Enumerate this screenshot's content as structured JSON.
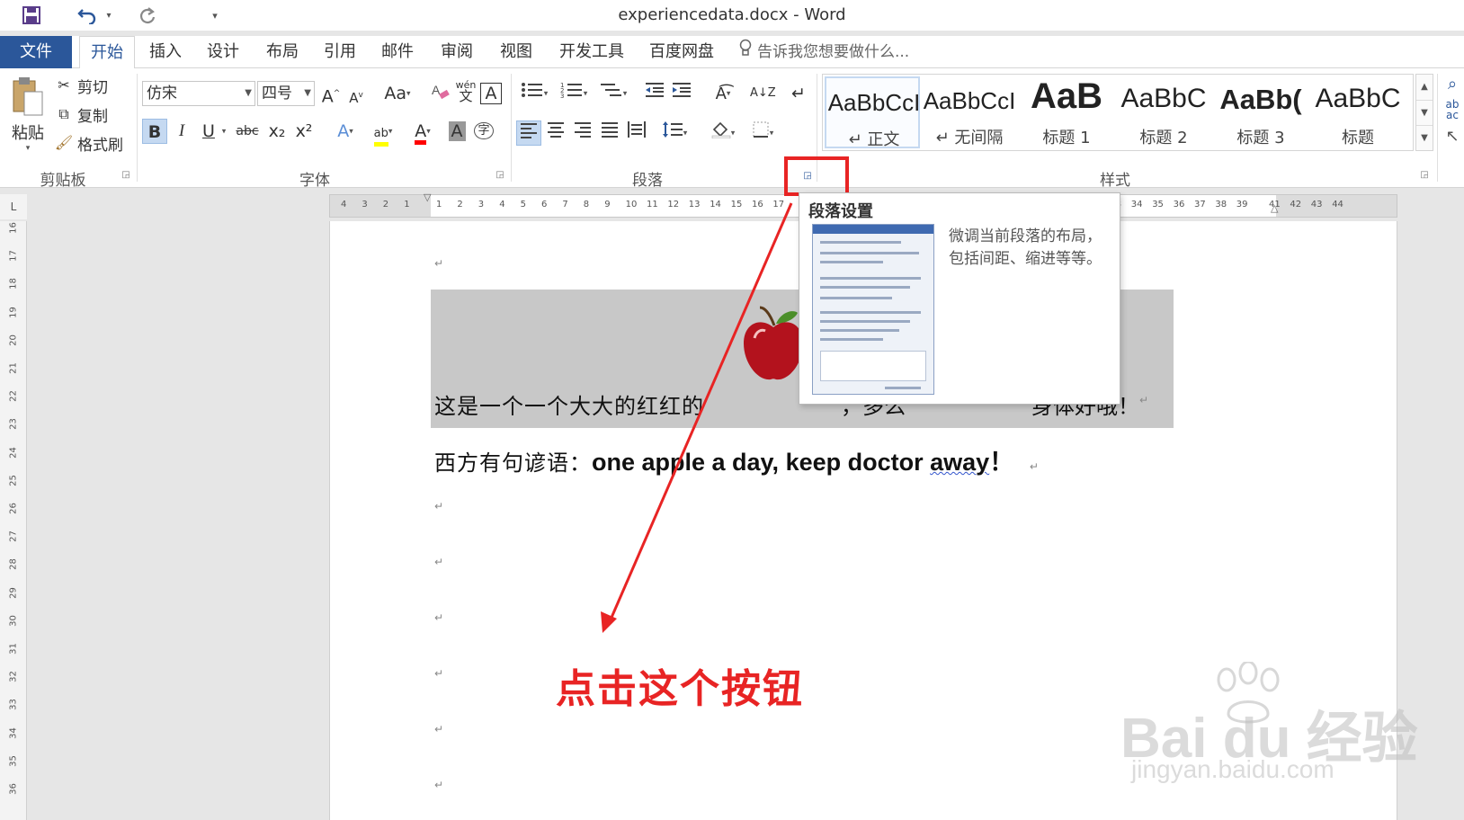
{
  "window": {
    "title": "experiencedata.docx - Word"
  },
  "quick_access": {
    "redo_dropdown": "▾",
    "customize": "▾"
  },
  "tabs": [
    {
      "label": "文件"
    },
    {
      "label": "开始"
    },
    {
      "label": "插入"
    },
    {
      "label": "设计"
    },
    {
      "label": "布局"
    },
    {
      "label": "引用"
    },
    {
      "label": "邮件"
    },
    {
      "label": "审阅"
    },
    {
      "label": "视图"
    },
    {
      "label": "开发工具"
    },
    {
      "label": "百度网盘"
    }
  ],
  "tell_me": {
    "placeholder": "告诉我您想要做什么..."
  },
  "clipboard": {
    "paste": "粘贴",
    "cut": "剪切",
    "copy": "复制",
    "format_painter": "格式刷",
    "group": "剪贴板"
  },
  "font": {
    "name": "仿宋",
    "size": "四号",
    "group": "字体",
    "grow": "A",
    "shrink": "A",
    "case": "Aa",
    "phonetic_top": "wén",
    "phonetic_bottom": "文",
    "border_char": "A",
    "bold": "B",
    "italic": "I",
    "underline": "U",
    "strike": "abc",
    "sub": "x₂",
    "sup": "x²",
    "effects": "A",
    "highlight": "ab",
    "color": "A",
    "shading": "A",
    "enclose": "字"
  },
  "paragraph": {
    "group": "段落",
    "sort": "A↓Z",
    "marks": "↵"
  },
  "styles": {
    "group": "样式",
    "items": [
      {
        "preview": "AaBbCcI",
        "name": "正文"
      },
      {
        "preview": "AaBbCcI",
        "name": "无间隔"
      },
      {
        "preview": "AaB",
        "name": "标题 1"
      },
      {
        "preview": "AaBbC",
        "name": "标题 2"
      },
      {
        "preview": "AaBb(",
        "name": "标题 3"
      },
      {
        "preview": "AaBbC",
        "name": "标题"
      }
    ]
  },
  "ruler": {
    "left": [
      "4",
      "3",
      "2",
      "1"
    ],
    "right": [
      "1",
      "2",
      "3",
      "4",
      "5",
      "6",
      "7",
      "8",
      "9",
      "10",
      "11",
      "12",
      "13",
      "14",
      "15",
      "16",
      "17"
    ],
    "far": [
      "2",
      "33",
      "34",
      "35",
      "36",
      "37",
      "38",
      "39"
    ],
    "end": [
      "41",
      "42",
      "43",
      "44"
    ],
    "vertical": [
      "16",
      "17",
      "18",
      "19",
      "20",
      "21",
      "22",
      "23",
      "24",
      "25",
      "26",
      "27",
      "28",
      "29",
      "30",
      "31",
      "32",
      "33",
      "34",
      "35",
      "36"
    ],
    "corner": "L"
  },
  "document": {
    "line1_a": "这是一个一个大大的红红的",
    "line1_b": "，多么",
    "line1_c": "身体好哦！",
    "line2_cn": "西方有句谚语：",
    "line2_en_a": "one apple a day, keep doctor ",
    "line2_en_b": "away",
    "line2_en_c": "！",
    "para_mark": "↵"
  },
  "tooltip": {
    "title": "段落设置",
    "description": "微调当前段落的布局，包括间距、缩进等等。"
  },
  "annotation": {
    "text": "点击这个按钮"
  },
  "watermark": {
    "brand": "Bai  du 经验",
    "url": "jingyan.baidu.com"
  },
  "colors": {
    "accent": "#2b579a",
    "annotation": "#e82424",
    "highlight": "#ffff00",
    "font_color": "#ff0000"
  }
}
